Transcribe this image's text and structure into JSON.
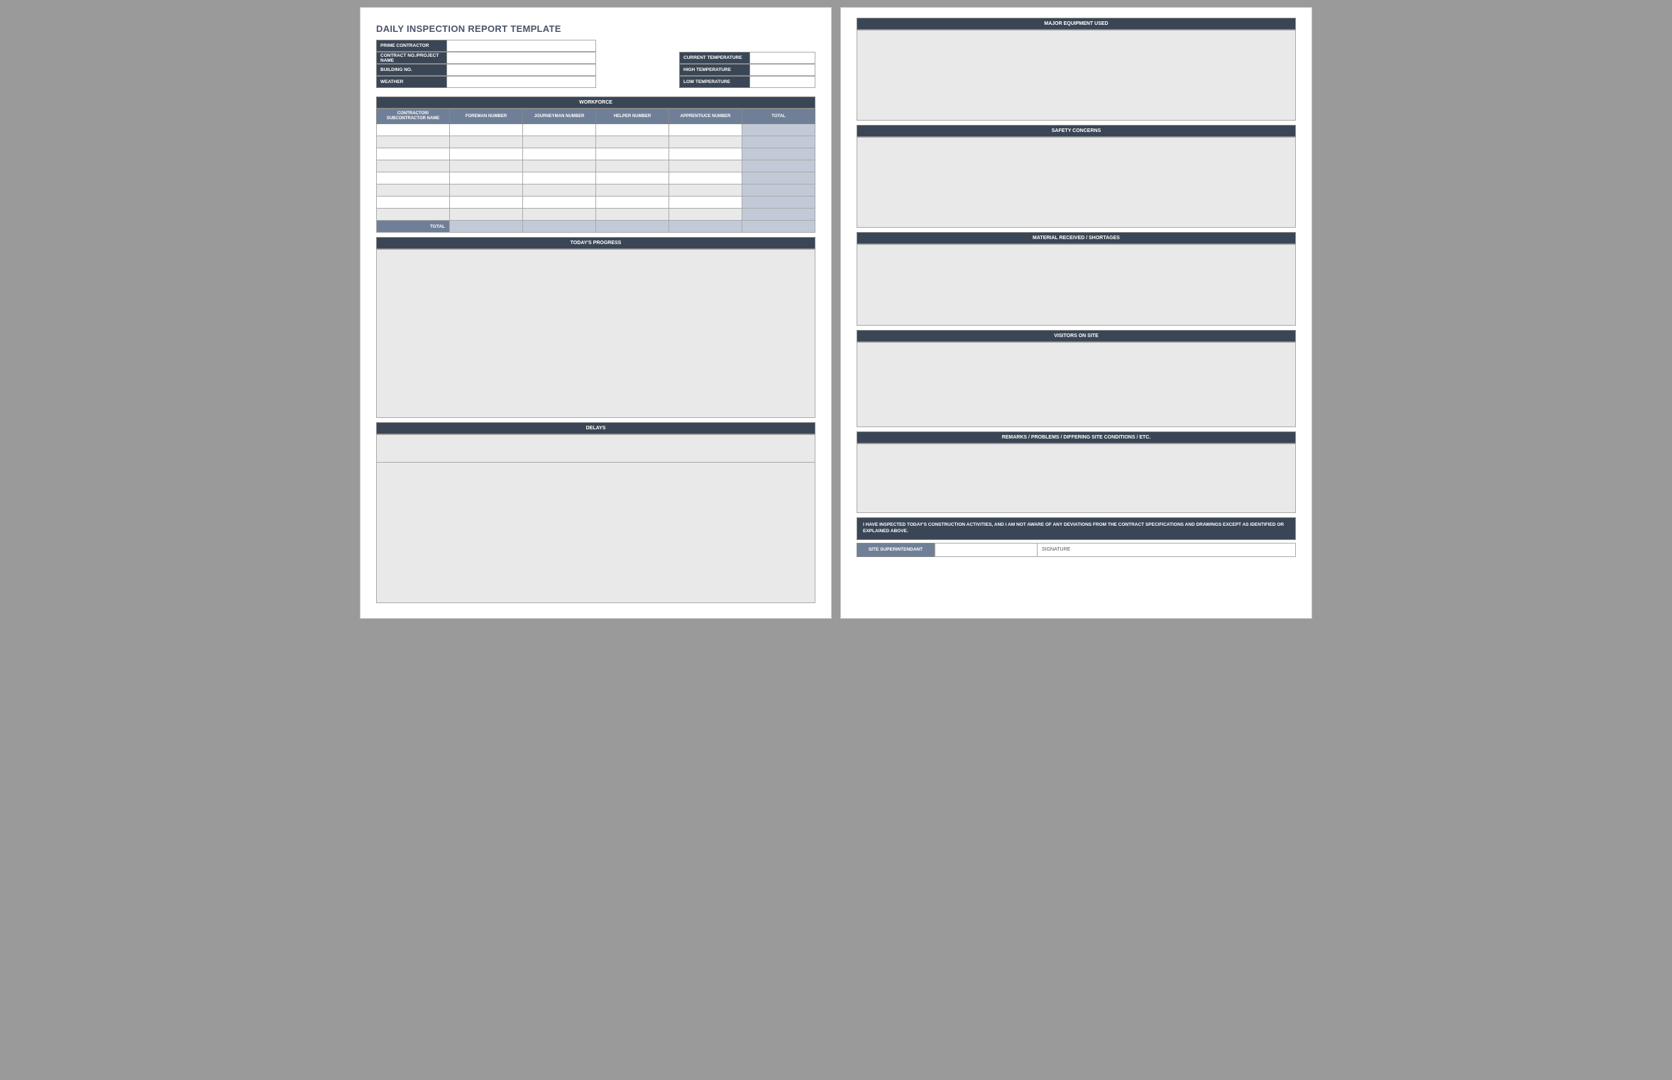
{
  "title": "DAILY INSPECTION REPORT TEMPLATE",
  "info_left": {
    "prime_contractor": "PRIME CONTRACTOR",
    "contract_no": "CONTRACT NO./PROJECT NAME",
    "building_no": "BUILDING NO.",
    "weather": "WEATHER"
  },
  "info_right": {
    "current_temp": "CURRENT TEMPERATURE",
    "high_temp": "HIGH TEMPERATURE",
    "low_temp": "LOW TEMPERATURE"
  },
  "workforce": {
    "header": "WORKFORCE",
    "columns": [
      "CONTRACTOR/ SUBCONTRACTOR NAME",
      "FOREMAN NUMBER",
      "JOURNEYMAN NUMBER",
      "HELPER NUMBER",
      "APPRENTIUCE NUMBER",
      "TOTAL"
    ],
    "total_label": "TOTAL"
  },
  "sections_page1": {
    "progress": "TODAY'S PROGRESS",
    "delays": "DELAYS"
  },
  "sections_page2": {
    "equipment": "MAJOR EQUIPMENT USED",
    "safety": "SAFETY CONCERNS",
    "material": "MATERIAL RECEIVED / SHORTAGES",
    "visitors": "VISITORS ON SITE",
    "remarks": "REMARKS / PROBLEMS / DIFFERING SITE CONDITIONS / ETC."
  },
  "disclaimer": "I HAVE INSPECTED TODAY'S CONSTRUCTION ACTIVITIES, AND I AM NOT AWARE OF ANY DEVIATIONS FROM THE CONTRACT SPECIFICATIONS AND DRAWINGS EXCEPT AS IDENTIFIED OR EXPLAINED ABOVE.",
  "signature": {
    "superintendant": "SITE SUPERINTENDANT",
    "signature": "SIGNATURE"
  }
}
